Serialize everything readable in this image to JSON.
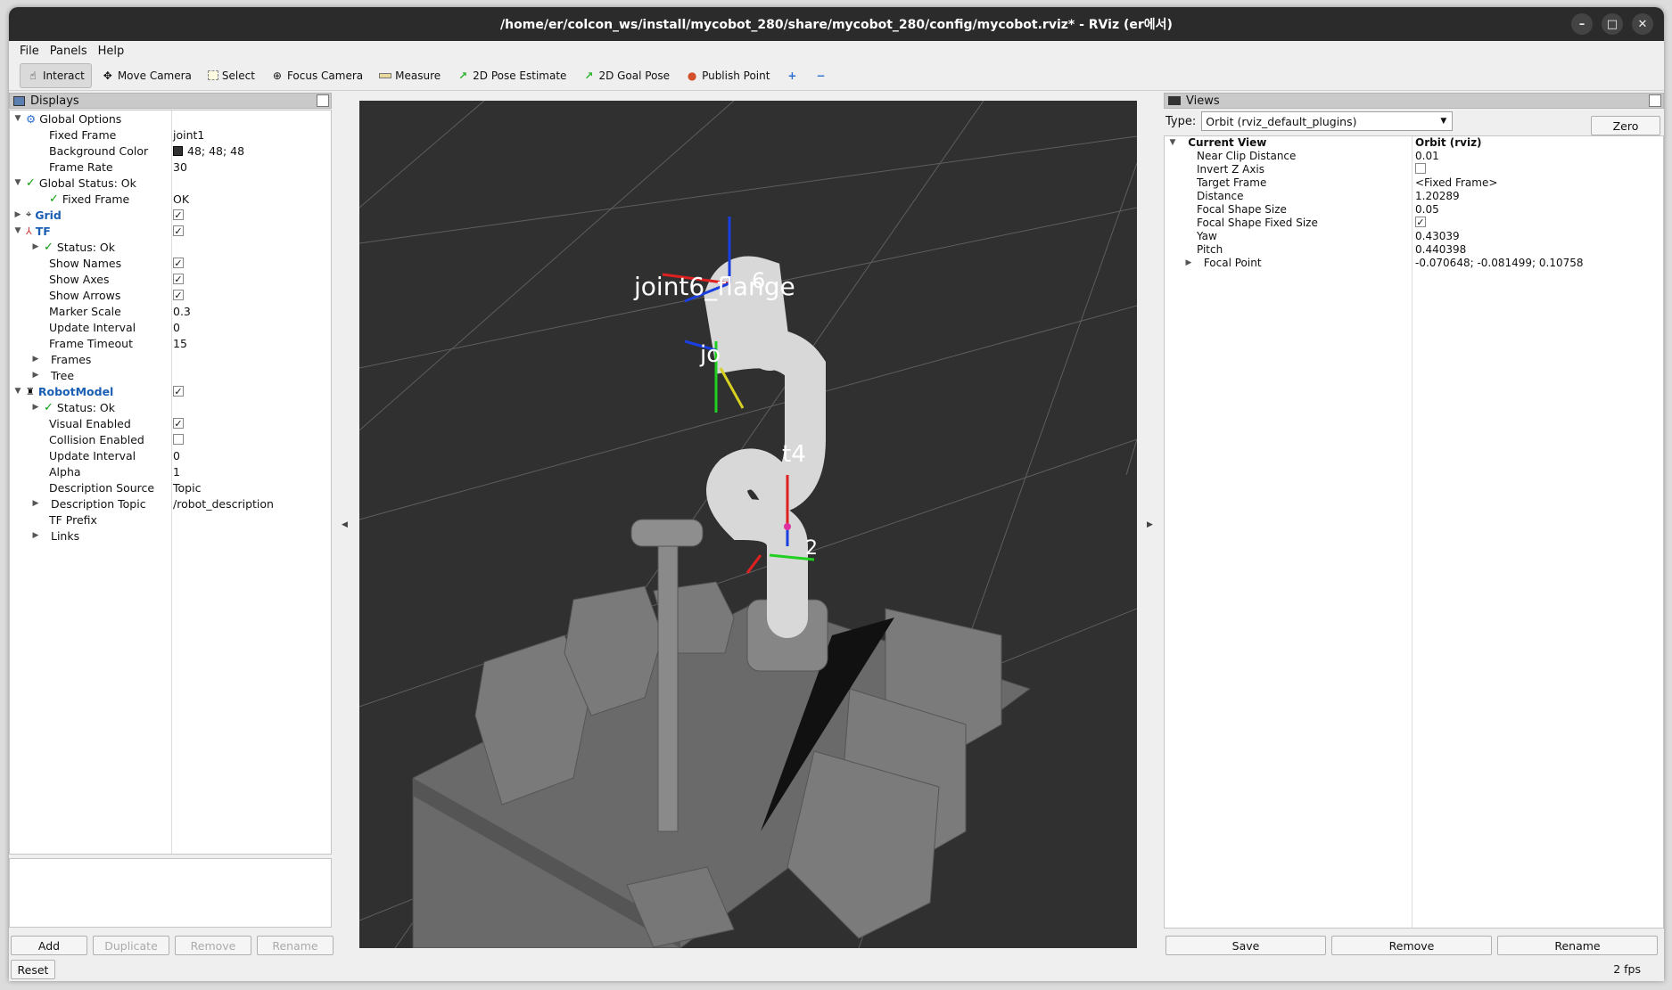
{
  "window": {
    "title": "/home/er/colcon_ws/install/mycobot_280/share/mycobot_280/config/mycobot.rviz* - RViz (er에서)"
  },
  "menu": [
    "File",
    "Panels",
    "Help"
  ],
  "toolbar": {
    "interact": "Interact",
    "move_camera": "Move Camera",
    "select": "Select",
    "focus_camera": "Focus Camera",
    "measure": "Measure",
    "pose_estimate": "2D Pose Estimate",
    "goal_pose": "2D Goal Pose",
    "publish_point": "Publish Point"
  },
  "displays": {
    "title": "Displays",
    "global_options": "Global Options",
    "fixed_frame": {
      "label": "Fixed Frame",
      "value": "joint1"
    },
    "background_color": {
      "label": "Background Color",
      "value": "48; 48; 48"
    },
    "frame_rate": {
      "label": "Frame Rate",
      "value": "30"
    },
    "global_status": "Global Status: Ok",
    "gs_fixed_frame": {
      "label": "Fixed Frame",
      "value": "OK"
    },
    "grid": "Grid",
    "tf": "TF",
    "tf_status": "Status: Ok",
    "show_names": "Show Names",
    "show_axes": "Show Axes",
    "show_arrows": "Show Arrows",
    "marker_scale": {
      "label": "Marker Scale",
      "value": "0.3"
    },
    "update_interval": {
      "label": "Update Interval",
      "value": "0"
    },
    "frame_timeout": {
      "label": "Frame Timeout",
      "value": "15"
    },
    "frames": "Frames",
    "tree": "Tree",
    "robot_model": "RobotModel",
    "rm_status": "Status: Ok",
    "visual_enabled": "Visual Enabled",
    "collision_enabled": "Collision Enabled",
    "rm_update_interval": {
      "label": "Update Interval",
      "value": "0"
    },
    "alpha": {
      "label": "Alpha",
      "value": "1"
    },
    "description_source": {
      "label": "Description Source",
      "value": "Topic"
    },
    "description_topic": {
      "label": "Description Topic",
      "value": "/robot_description"
    },
    "tf_prefix": "TF Prefix",
    "links": "Links",
    "buttons": {
      "add": "Add",
      "duplicate": "Duplicate",
      "remove": "Remove",
      "rename": "Rename",
      "reset": "Reset"
    }
  },
  "viewport": {
    "label_flange": "joint6_flange",
    "label_6": "6",
    "label_jo": "jo",
    "label_t4": "t4",
    "label_2": "2"
  },
  "views": {
    "title": "Views",
    "type_label": "Type:",
    "type_value": "Orbit (rviz_default_plugins)",
    "zero": "Zero",
    "current_view": {
      "label": "Current View",
      "value": "Orbit (rviz)"
    },
    "rows": [
      {
        "label": "Near Clip Distance",
        "value": "0.01"
      },
      {
        "label": "Invert Z Axis",
        "value": ""
      },
      {
        "label": "Target Frame",
        "value": "<Fixed Frame>"
      },
      {
        "label": "Distance",
        "value": "1.20289"
      },
      {
        "label": "Focal Shape Size",
        "value": "0.05"
      },
      {
        "label": "Focal Shape Fixed Size",
        "value": ""
      },
      {
        "label": "Yaw",
        "value": "0.43039"
      },
      {
        "label": "Pitch",
        "value": "0.440398"
      },
      {
        "label": "Focal Point",
        "value": "-0.070648; -0.081499; 0.10758"
      }
    ],
    "buttons": {
      "save": "Save",
      "remove": "Remove",
      "rename": "Rename"
    },
    "fps": "2 fps"
  }
}
